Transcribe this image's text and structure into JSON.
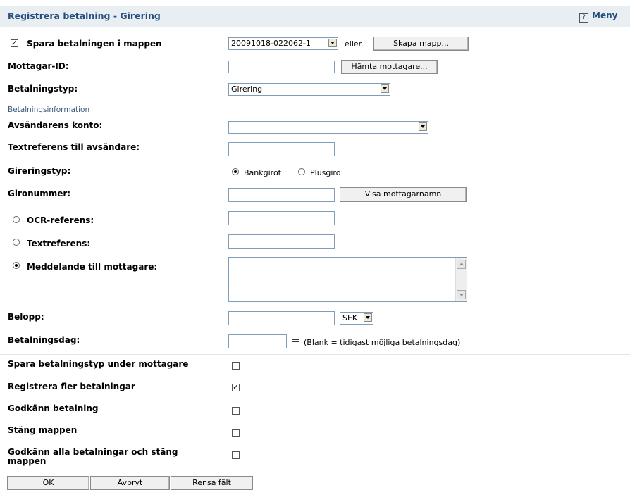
{
  "header": {
    "title": "Registrera betalning - Girering",
    "menu_label": "Meny",
    "menu_icon": "?"
  },
  "folder": {
    "save_label": "Spara betalningen i mappen",
    "save_checked": true,
    "folder_value": "20091018-022062-1",
    "or_label": "eller",
    "create_button": "Skapa mapp..."
  },
  "recipient": {
    "label": "Mottagar-ID:",
    "value": "",
    "fetch_button": "Hämta mottagare..."
  },
  "payment_type": {
    "label": "Betalningstyp:",
    "value": "Girering"
  },
  "section_title": "Betalningsinformation",
  "sender_account": {
    "label": "Avsändarens konto:",
    "value": ""
  },
  "sender_ref": {
    "label": "Textreferens till avsändare:",
    "value": ""
  },
  "giro_type": {
    "label": "Gireringstyp:",
    "option_bankgiro": "Bankgirot",
    "option_plusgiro": "Plusgiro",
    "selected": "Bankgirot"
  },
  "giro_number": {
    "label": "Gironummer:",
    "value": "",
    "show_button": "Visa mottagarnamn"
  },
  "ocr": {
    "label": "OCR-referens:",
    "value": ""
  },
  "text_ref": {
    "label": "Textreferens:",
    "value": ""
  },
  "message": {
    "label": "Meddelande till mottagare:",
    "value": ""
  },
  "amount": {
    "label": "Belopp:",
    "value": "",
    "currency": "SEK"
  },
  "payment_date": {
    "label": "Betalningsdag:",
    "value": "",
    "hint": "(Blank = tidigast möjliga betalningsdag)"
  },
  "options": {
    "save_type": "Spara betalningstyp under mottagare",
    "more_payments": "Registrera fler betalningar",
    "approve": "Godkänn betalning",
    "close_folder": "Stäng mappen",
    "approve_all_1": "Godkänn alla betalningar och stäng",
    "approve_all_2": "mappen"
  },
  "buttons": {
    "ok": "OK",
    "cancel": "Avbryt",
    "clear": "Rensa fält"
  }
}
